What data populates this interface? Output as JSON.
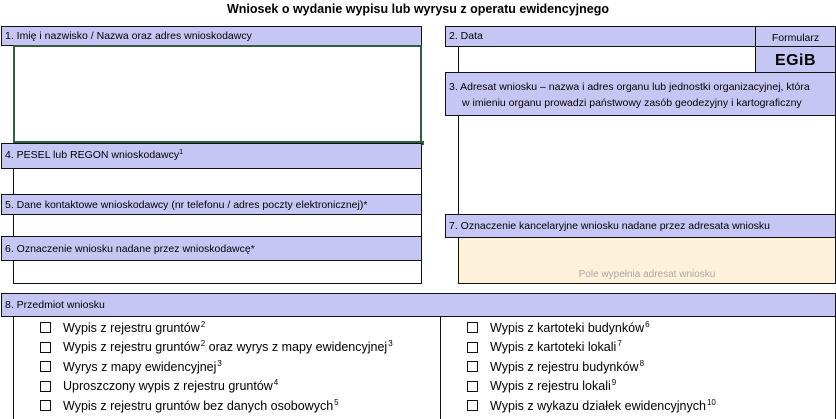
{
  "page_title": "Wniosek o wydanie wypisu lub wyrysu z operatu ewidencyjnego",
  "sections": {
    "s1": {
      "label": "1. Imię i nazwisko / Nazwa oraz adres wnioskodawcy"
    },
    "s2": {
      "label": "2. Data"
    },
    "formularz": {
      "label": "Formularz",
      "code": "EGiB"
    },
    "s3": {
      "label_line1": "3. Adresat wniosku – nazwa i adres organu lub jednostki organizacyjnej, która",
      "label_line2": "w imieniu organu prowadzi państwowy zasób geodezyjny i kartograficzny"
    },
    "s4": {
      "label": "4. PESEL lub REGON wnioskodawcy",
      "sup": "1"
    },
    "s5": {
      "label": "5. Dane kontaktowe wnioskodawcy (nr telefonu / adres poczty elektronicznej)*"
    },
    "s6": {
      "label": "6. Oznaczenie wniosku nadane przez wnioskodawcę*"
    },
    "s7": {
      "label": "7. Oznaczenie kancelaryjne wniosku nadane przez adresata wniosku",
      "hint": "Pole wypełnia adresat wniosku"
    },
    "s8": {
      "label": "8. Przedmiot wniosku"
    }
  },
  "options_left": [
    {
      "parts": [
        "Wypis z rejestru gruntów",
        "2"
      ]
    },
    {
      "parts": [
        "Wypis z rejestru gruntów",
        "2",
        " oraz wyrys z mapy ewidencyjnej",
        "3"
      ]
    },
    {
      "parts": [
        "Wyrys z mapy ewidencyjnej",
        "3"
      ]
    },
    {
      "parts": [
        "Uproszczony wypis z rejestru gruntów",
        "4"
      ]
    },
    {
      "parts": [
        "Wypis z rejestru gruntów bez danych osobowych",
        "5"
      ]
    }
  ],
  "options_right": [
    {
      "parts": [
        "Wypis z kartoteki budynków",
        "6"
      ]
    },
    {
      "parts": [
        "Wypis z kartoteki lokali",
        "7"
      ]
    },
    {
      "parts": [
        "Wypis z rejestru budynków",
        "8"
      ]
    },
    {
      "parts": [
        "Wypis z rejestru lokali",
        "9"
      ]
    },
    {
      "parts": [
        "Wypis z wykazu działek ewidencyjnych",
        "10"
      ]
    }
  ],
  "colors": {
    "label_bg": "#c6c6f5",
    "hint_bg": "#fdf1d9",
    "active_border": "#2f5f3f"
  }
}
